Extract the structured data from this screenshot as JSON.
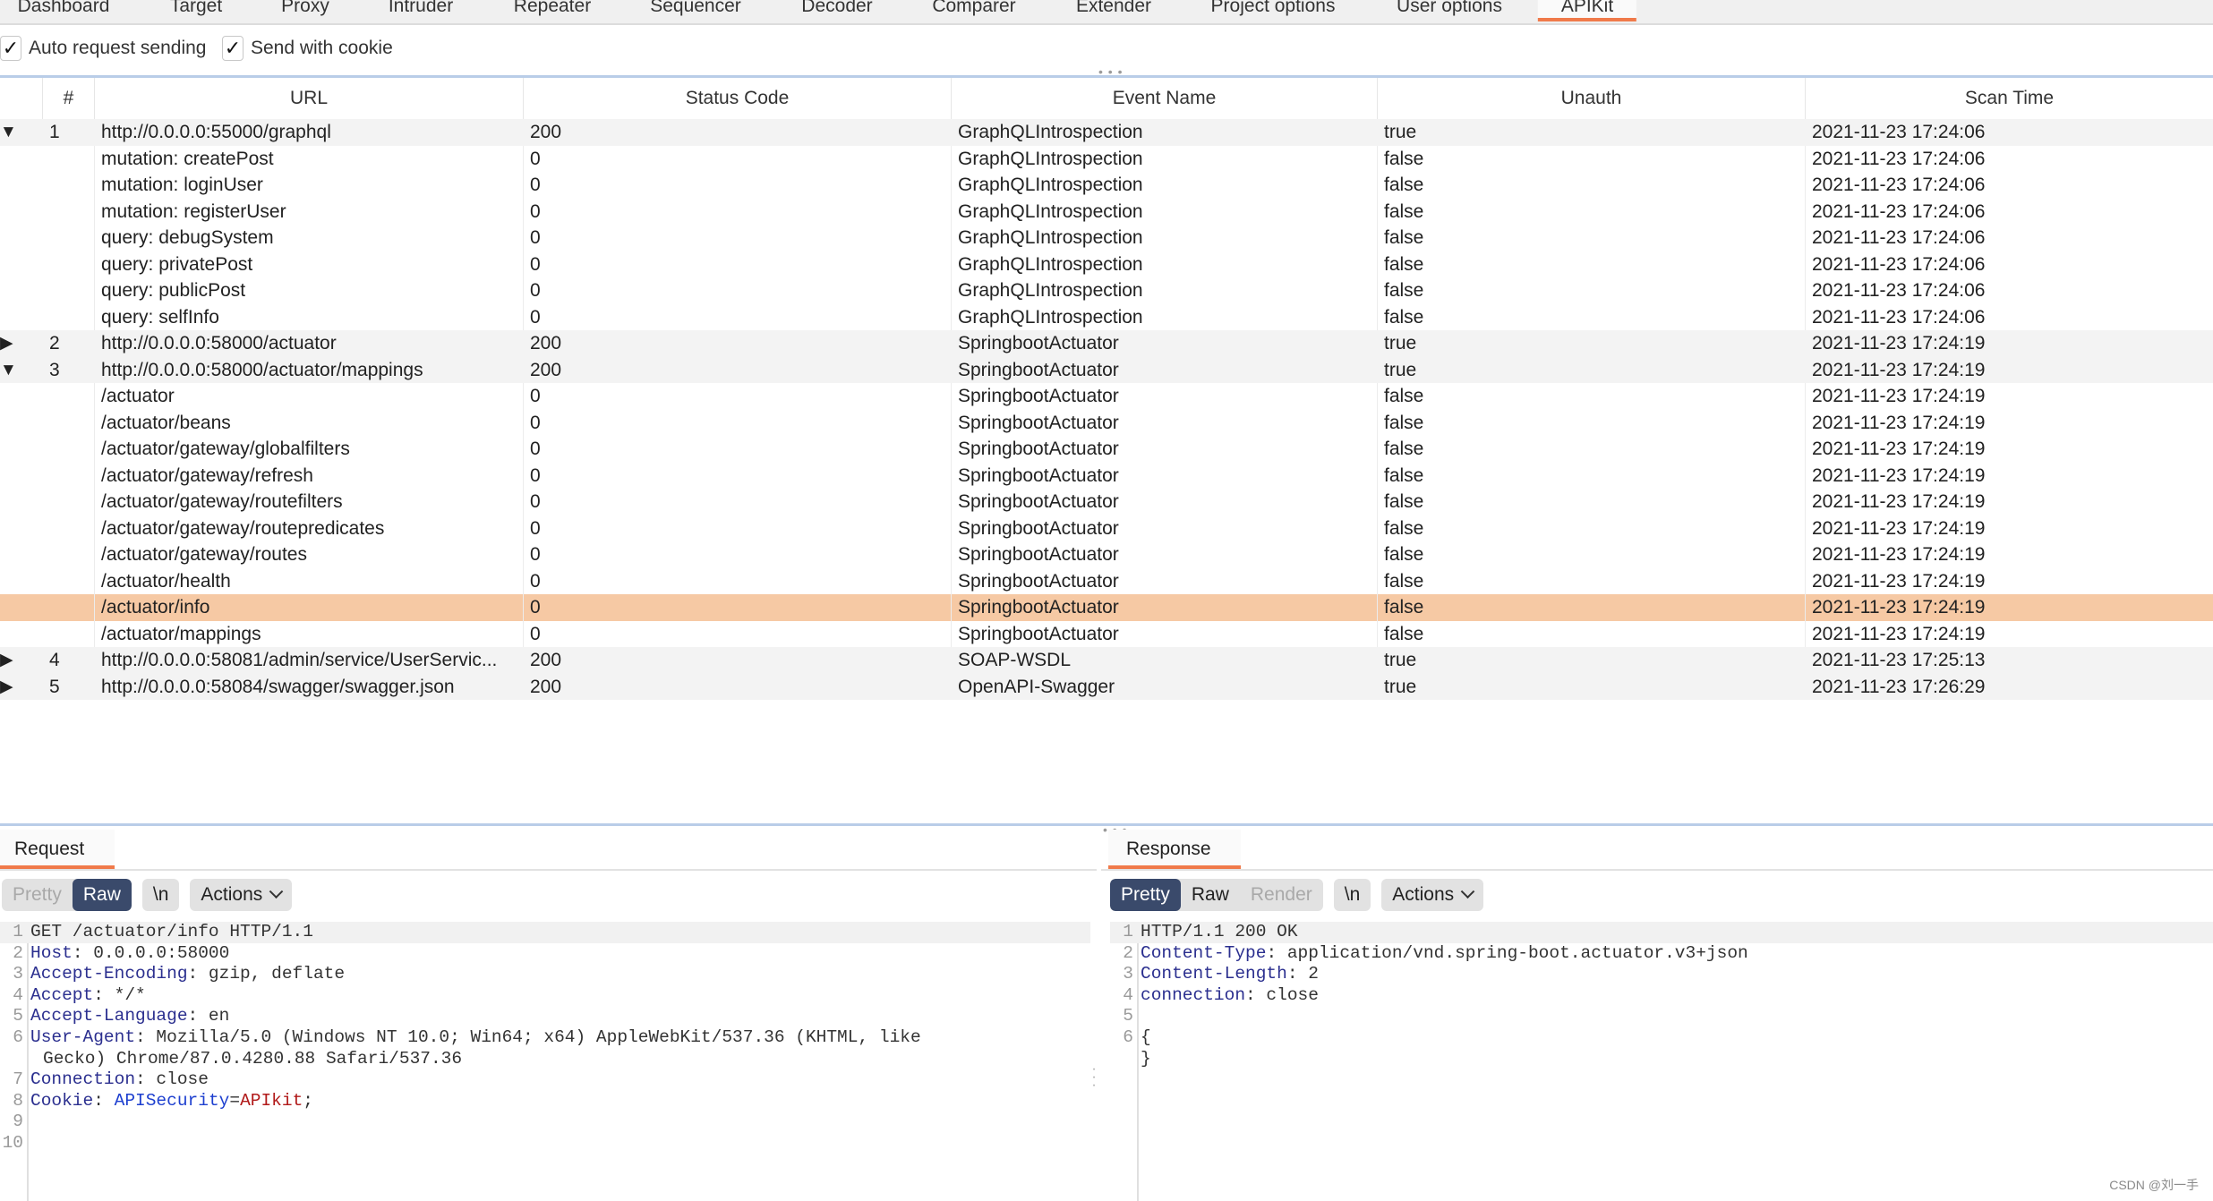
{
  "top_tabs": [
    {
      "label": "Dashboard",
      "active": false
    },
    {
      "label": "Target",
      "active": false
    },
    {
      "label": "Proxy",
      "active": false
    },
    {
      "label": "Intruder",
      "active": false
    },
    {
      "label": "Repeater",
      "active": false
    },
    {
      "label": "Sequencer",
      "active": false
    },
    {
      "label": "Decoder",
      "active": false
    },
    {
      "label": "Comparer",
      "active": false
    },
    {
      "label": "Extender",
      "active": false
    },
    {
      "label": "Project options",
      "active": false
    },
    {
      "label": "User options",
      "active": false
    },
    {
      "label": "APIKit",
      "active": true
    }
  ],
  "options": {
    "auto_request_sending": {
      "label": "Auto request sending",
      "checked": true
    },
    "send_with_cookie": {
      "label": "Send with cookie",
      "checked": true
    }
  },
  "table": {
    "columns": [
      "",
      "#",
      "URL",
      "Status Code",
      "Event Name",
      "Unauth",
      "Scan Time"
    ],
    "rows": [
      {
        "type": "parent",
        "expanded": true,
        "num": "1",
        "url": "http://0.0.0.0:55000/graphql",
        "status": "200",
        "event": "GraphQLIntrospection",
        "unauth": "true",
        "time": "2021-11-23 17:24:06"
      },
      {
        "type": "child",
        "url": "mutation: createPost",
        "status": "0",
        "event": "GraphQLIntrospection",
        "unauth": "false",
        "time": "2021-11-23 17:24:06"
      },
      {
        "type": "child",
        "url": "mutation: loginUser",
        "status": "0",
        "event": "GraphQLIntrospection",
        "unauth": "false",
        "time": "2021-11-23 17:24:06"
      },
      {
        "type": "child",
        "url": "mutation: registerUser",
        "status": "0",
        "event": "GraphQLIntrospection",
        "unauth": "false",
        "time": "2021-11-23 17:24:06"
      },
      {
        "type": "child",
        "url": "query: debugSystem",
        "status": "0",
        "event": "GraphQLIntrospection",
        "unauth": "false",
        "time": "2021-11-23 17:24:06"
      },
      {
        "type": "child",
        "url": "query: privatePost",
        "status": "0",
        "event": "GraphQLIntrospection",
        "unauth": "false",
        "time": "2021-11-23 17:24:06"
      },
      {
        "type": "child",
        "url": "query: publicPost",
        "status": "0",
        "event": "GraphQLIntrospection",
        "unauth": "false",
        "time": "2021-11-23 17:24:06"
      },
      {
        "type": "child",
        "url": "query: selfInfo",
        "status": "0",
        "event": "GraphQLIntrospection",
        "unauth": "false",
        "time": "2021-11-23 17:24:06"
      },
      {
        "type": "parent",
        "expanded": false,
        "num": "2",
        "url": "http://0.0.0.0:58000/actuator",
        "status": "200",
        "event": "SpringbootActuator",
        "unauth": "true",
        "time": "2021-11-23 17:24:19"
      },
      {
        "type": "parent",
        "expanded": true,
        "num": "3",
        "url": "http://0.0.0.0:58000/actuator/mappings",
        "status": "200",
        "event": "SpringbootActuator",
        "unauth": "true",
        "time": "2021-11-23 17:24:19"
      },
      {
        "type": "child",
        "url": "/actuator",
        "status": "0",
        "event": "SpringbootActuator",
        "unauth": "false",
        "time": "2021-11-23 17:24:19"
      },
      {
        "type": "child",
        "url": "/actuator/beans",
        "status": "0",
        "event": "SpringbootActuator",
        "unauth": "false",
        "time": "2021-11-23 17:24:19"
      },
      {
        "type": "child",
        "url": "/actuator/gateway/globalfilters",
        "status": "0",
        "event": "SpringbootActuator",
        "unauth": "false",
        "time": "2021-11-23 17:24:19"
      },
      {
        "type": "child",
        "url": "/actuator/gateway/refresh",
        "status": "0",
        "event": "SpringbootActuator",
        "unauth": "false",
        "time": "2021-11-23 17:24:19"
      },
      {
        "type": "child",
        "url": "/actuator/gateway/routefilters",
        "status": "0",
        "event": "SpringbootActuator",
        "unauth": "false",
        "time": "2021-11-23 17:24:19"
      },
      {
        "type": "child",
        "url": "/actuator/gateway/routepredicates",
        "status": "0",
        "event": "SpringbootActuator",
        "unauth": "false",
        "time": "2021-11-23 17:24:19"
      },
      {
        "type": "child",
        "url": "/actuator/gateway/routes",
        "status": "0",
        "event": "SpringbootActuator",
        "unauth": "false",
        "time": "2021-11-23 17:24:19"
      },
      {
        "type": "child",
        "url": "/actuator/health",
        "status": "0",
        "event": "SpringbootActuator",
        "unauth": "false",
        "time": "2021-11-23 17:24:19"
      },
      {
        "type": "child",
        "selected": true,
        "url": "/actuator/info",
        "status": "0",
        "event": "SpringbootActuator",
        "unauth": "false",
        "time": "2021-11-23 17:24:19"
      },
      {
        "type": "child",
        "url": "/actuator/mappings",
        "status": "0",
        "event": "SpringbootActuator",
        "unauth": "false",
        "time": "2021-11-23 17:24:19"
      },
      {
        "type": "parent",
        "expanded": false,
        "num": "4",
        "url": "http://0.0.0.0:58081/admin/service/UserServic...",
        "status": "200",
        "event": "SOAP-WSDL",
        "unauth": "true",
        "time": "2021-11-23 17:25:13"
      },
      {
        "type": "parent",
        "expanded": false,
        "num": "5",
        "url": "http://0.0.0.0:58084/swagger/swagger.json",
        "status": "200",
        "event": "OpenAPI-Swagger",
        "unauth": "true",
        "time": "2021-11-23 17:26:29"
      }
    ]
  },
  "request": {
    "tab_label": "Request",
    "modes": [
      {
        "label": "Pretty",
        "state": "dim"
      },
      {
        "label": "Raw",
        "state": "on"
      }
    ],
    "newline_label": "\\n",
    "actions_label": "Actions",
    "lines": [
      {
        "n": "1",
        "parts": [
          {
            "t": "GET /actuator/info HTTP/1.1",
            "c": ""
          }
        ],
        "hl": true
      },
      {
        "n": "2",
        "parts": [
          {
            "t": "Host",
            "c": "hk"
          },
          {
            "t": ": 0.0.0.0:58000",
            "c": ""
          }
        ]
      },
      {
        "n": "3",
        "parts": [
          {
            "t": "Accept-Encoding",
            "c": "hk"
          },
          {
            "t": ": gzip, deflate",
            "c": ""
          }
        ]
      },
      {
        "n": "4",
        "parts": [
          {
            "t": "Accept",
            "c": "hk"
          },
          {
            "t": ": */*",
            "c": ""
          }
        ]
      },
      {
        "n": "5",
        "parts": [
          {
            "t": "Accept-Language",
            "c": "hk"
          },
          {
            "t": ": en",
            "c": ""
          }
        ]
      },
      {
        "n": "6",
        "parts": [
          {
            "t": "User-Agent",
            "c": "hk"
          },
          {
            "t": ": Mozilla/5.0 (Windows NT 10.0; Win64; x64) AppleWebKit/537.36 (KHTML, like",
            "c": ""
          }
        ]
      },
      {
        "n": "",
        "wrap": "Gecko) Chrome/87.0.4280.88 Safari/537.36"
      },
      {
        "n": "7",
        "parts": [
          {
            "t": "Connection",
            "c": "hk"
          },
          {
            "t": ": close",
            "c": ""
          }
        ]
      },
      {
        "n": "8",
        "parts": [
          {
            "t": "Cookie",
            "c": "hk"
          },
          {
            "t": ": ",
            "c": ""
          },
          {
            "t": "APISecurity",
            "c": "cv"
          },
          {
            "t": "=",
            "c": ""
          },
          {
            "t": "APIkit",
            "c": "cr"
          },
          {
            "t": ";",
            "c": ""
          }
        ]
      },
      {
        "n": "9",
        "parts": []
      },
      {
        "n": "10",
        "parts": []
      }
    ]
  },
  "response": {
    "tab_label": "Response",
    "modes": [
      {
        "label": "Pretty",
        "state": "on"
      },
      {
        "label": "Raw",
        "state": ""
      },
      {
        "label": "Render",
        "state": "dim"
      }
    ],
    "newline_label": "\\n",
    "actions_label": "Actions",
    "lines": [
      {
        "n": "1",
        "parts": [
          {
            "t": "HTTP/1.1 200 OK",
            "c": ""
          }
        ],
        "hl": true
      },
      {
        "n": "2",
        "parts": [
          {
            "t": "Content-Type",
            "c": "hk"
          },
          {
            "t": ": application/vnd.spring-boot.actuator.v3+json",
            "c": ""
          }
        ]
      },
      {
        "n": "3",
        "parts": [
          {
            "t": "Content-Length",
            "c": "hk"
          },
          {
            "t": ": 2",
            "c": ""
          }
        ]
      },
      {
        "n": "4",
        "parts": [
          {
            "t": "connection",
            "c": "hk"
          },
          {
            "t": ": close",
            "c": ""
          }
        ]
      },
      {
        "n": "5",
        "parts": []
      },
      {
        "n": "6",
        "parts": [
          {
            "t": "{",
            "c": ""
          }
        ]
      },
      {
        "n": "",
        "parts": [
          {
            "t": "}",
            "c": ""
          }
        ]
      }
    ]
  },
  "watermark": "CSDN @刘一手",
  "colors": {
    "accent": "#f07a4a",
    "selected_row": "#f6c9a4",
    "mode_active": "#3a4a6b"
  }
}
